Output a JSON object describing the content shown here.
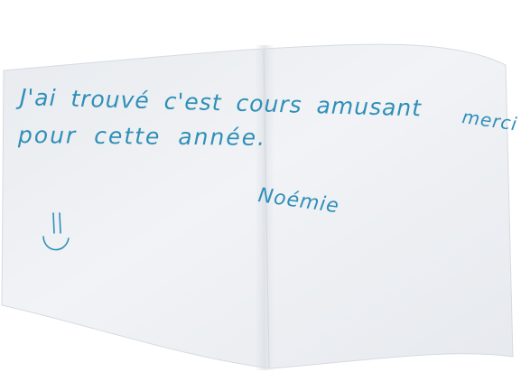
{
  "note": {
    "line1": "J'ai trouvé c'est cours amusant",
    "line1_end": "merci",
    "line2": "pour cette année.",
    "signature": "Noémie"
  },
  "colors": {
    "paper": "#eef0f3",
    "ink": "#2f8fb8",
    "background": "#ffffff"
  },
  "drawing": "smiley-face-doodle"
}
